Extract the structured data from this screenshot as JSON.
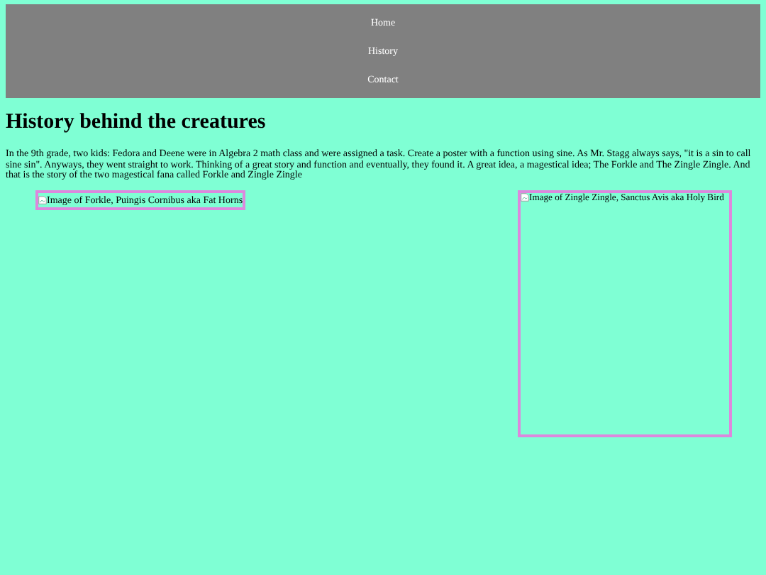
{
  "nav": [
    {
      "label": "Home"
    },
    {
      "label": "History"
    },
    {
      "label": "Contact"
    }
  ],
  "heading": "History behind the creatures",
  "paragraph": "In the 9th grade, two kids: Fedora and Deene were in Algebra 2 math class and were assigned a task. Create a poster with a function using sine. As Mr. Stagg always says, \"it is a sin to call sine sin\". Anyways, they went straight to work. Thinking of a great story and function and eventually, they found it. A great idea, a magestical idea; The Forkle and The Zingle Zingle. And that is the story of the two magestical fana called Forkle and Zingle Zingle",
  "images": [
    {
      "kind": "unsized",
      "alt": "Image of Forkle, Puingis Cornibus aka Fat Horns"
    },
    {
      "kind": "sized",
      "alt": "Image of Zingle Zingle, Sanctus Avis aka Holy Bird"
    }
  ]
}
